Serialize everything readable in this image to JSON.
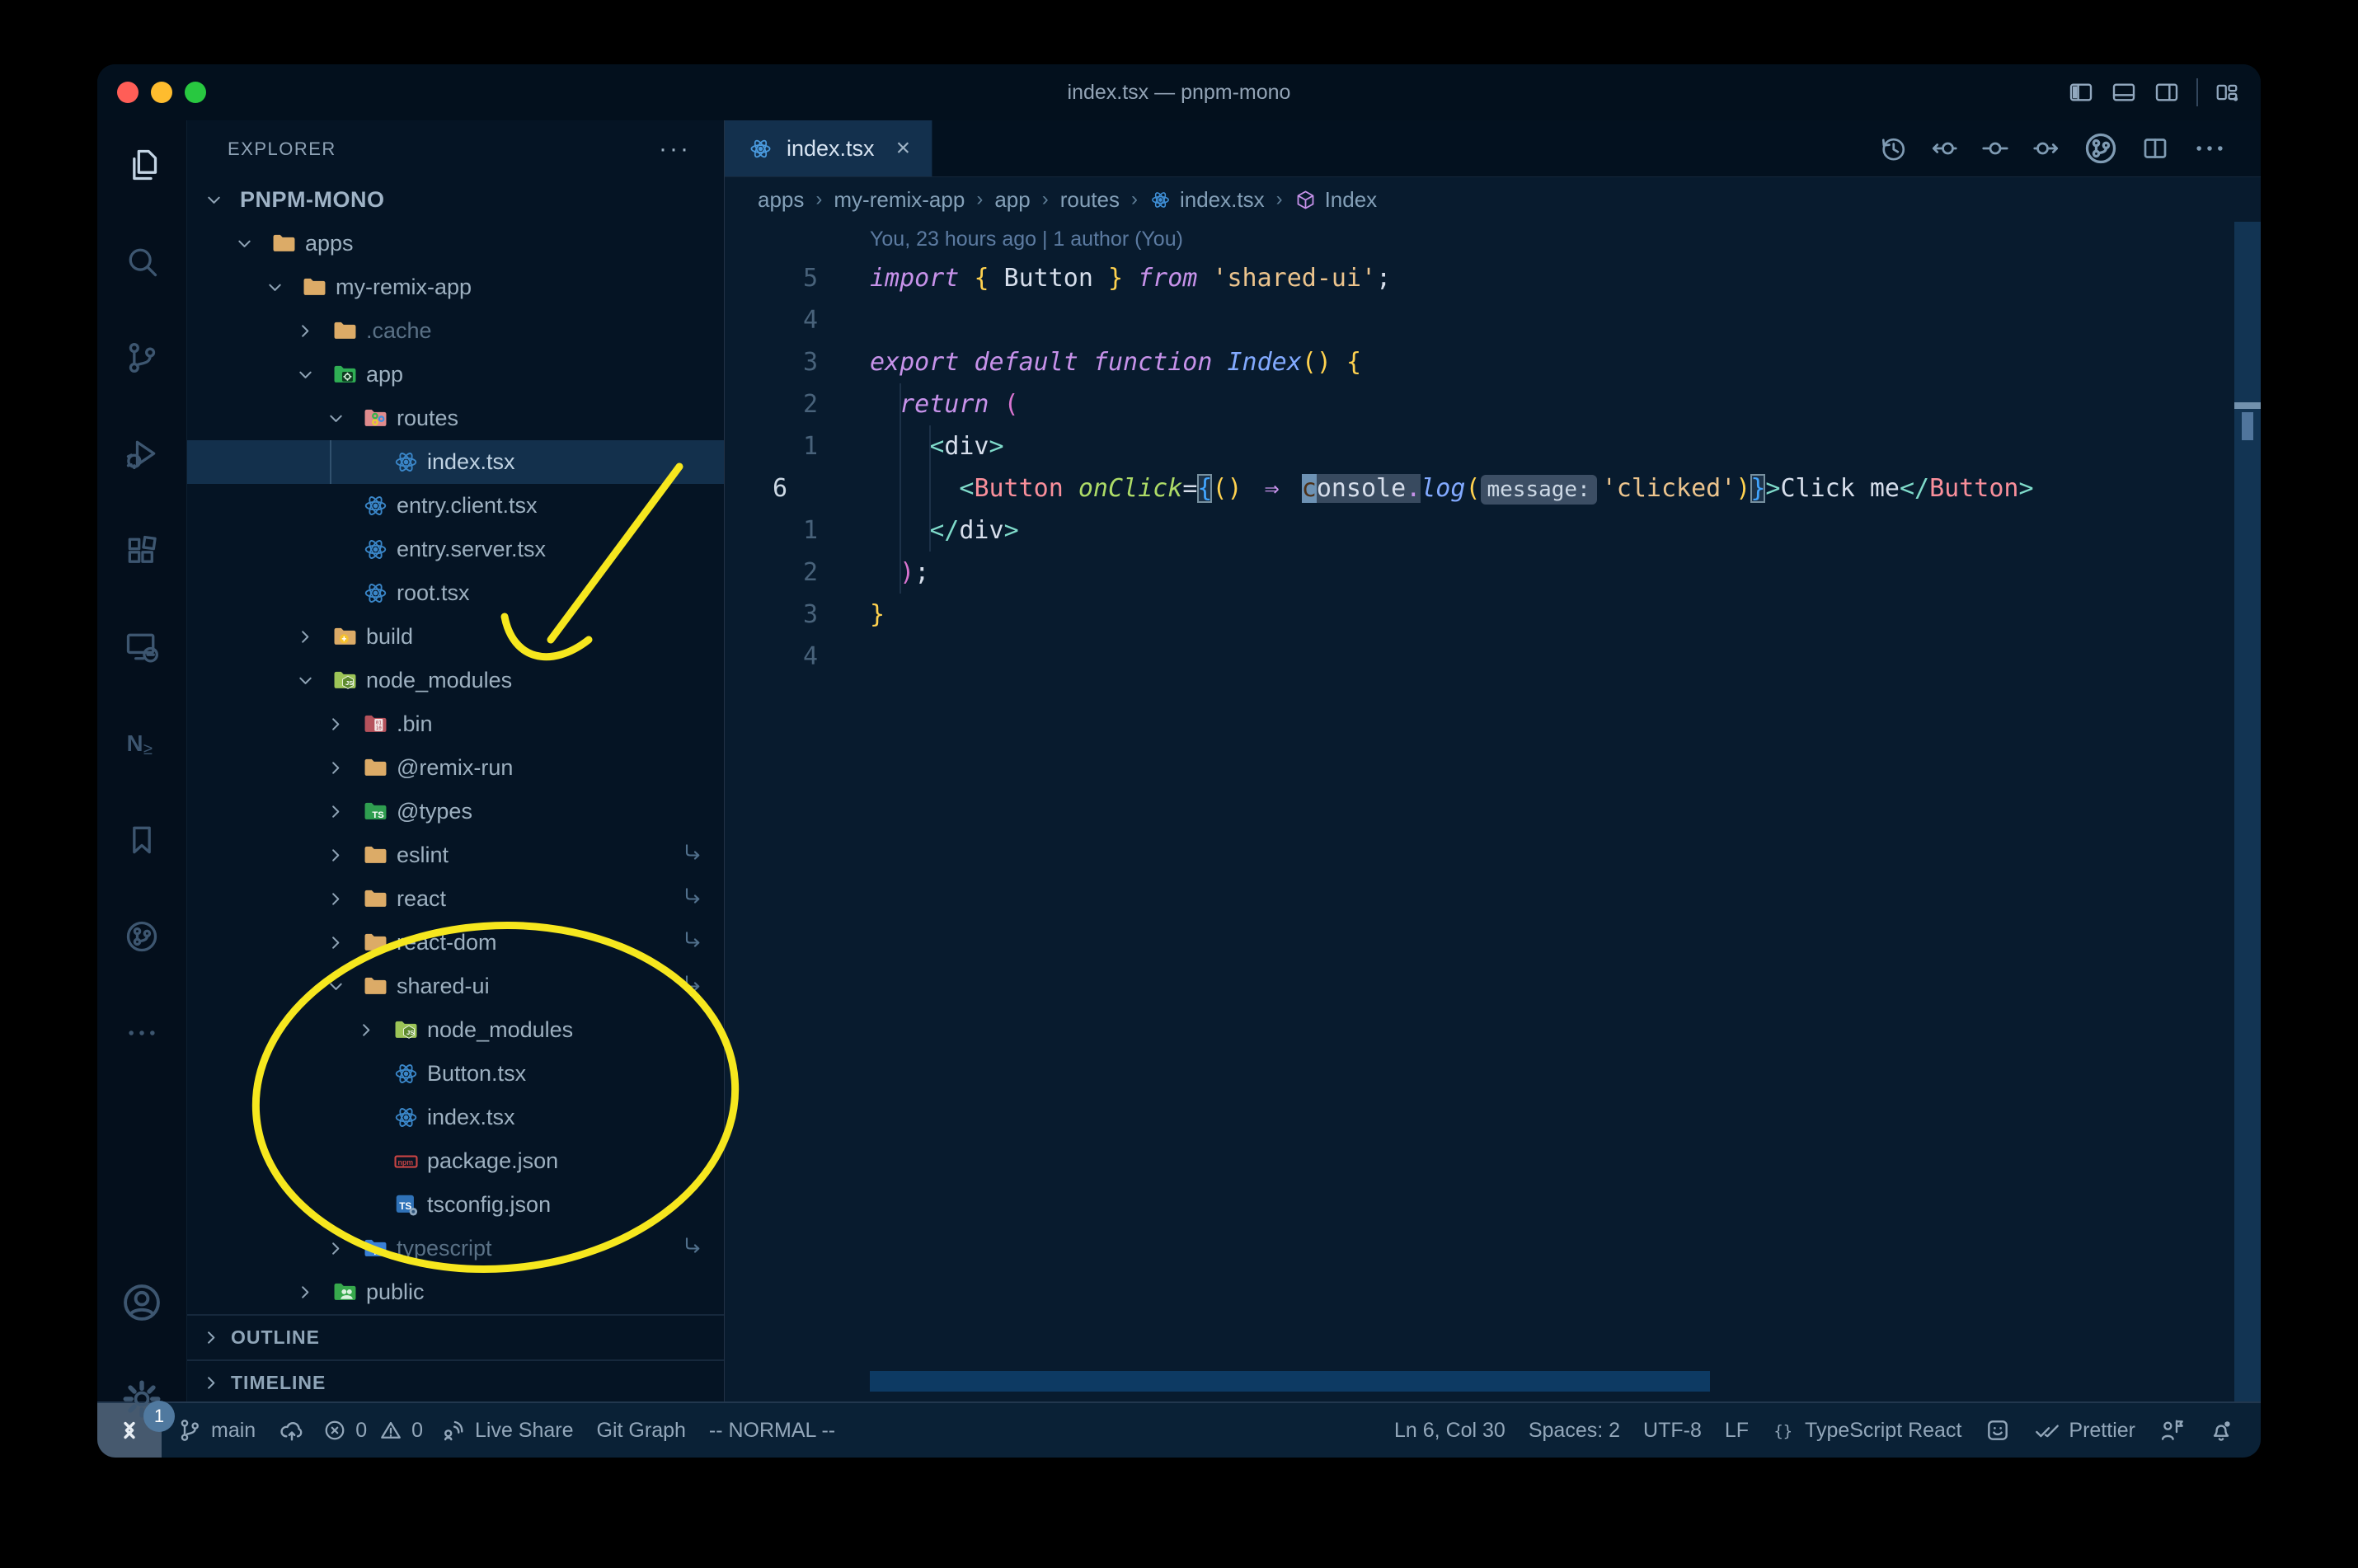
{
  "window": {
    "title": "index.tsx — pnpm-mono"
  },
  "titlebar_actions": [
    {
      "icon": "layout-sidebar-left",
      "name": "toggle-primary-sidebar"
    },
    {
      "icon": "layout-panel",
      "name": "toggle-panel"
    },
    {
      "icon": "layout-sidebar-right",
      "name": "toggle-secondary-sidebar"
    },
    {
      "icon": "sep",
      "name": "separator"
    },
    {
      "icon": "layout-customize",
      "name": "customize-layout"
    }
  ],
  "activity_bar": {
    "items": [
      {
        "icon": "files",
        "name": "explorer",
        "active": true
      },
      {
        "icon": "search",
        "name": "search"
      },
      {
        "icon": "source-control",
        "name": "source-control"
      },
      {
        "icon": "run-debug",
        "name": "run-and-debug"
      },
      {
        "icon": "extensions",
        "name": "extensions"
      },
      {
        "icon": "remote-explorer",
        "name": "remote-explorer"
      },
      {
        "icon": "nx-console",
        "name": "nx-console"
      },
      {
        "icon": "bookmarks",
        "name": "bookmarks"
      },
      {
        "icon": "git-graph",
        "name": "git-graph"
      },
      {
        "icon": "more",
        "name": "additional-views"
      }
    ],
    "bottom": [
      {
        "icon": "account",
        "name": "accounts"
      },
      {
        "icon": "settings",
        "name": "manage",
        "badge": "1"
      }
    ]
  },
  "sidebar": {
    "header": "EXPLORER",
    "header_more": "···",
    "tree": [
      {
        "label": "PNPM-MONO",
        "depth": 0,
        "chevron": "down",
        "root": true
      },
      {
        "label": "apps",
        "depth": 1,
        "icon": "folder-tan",
        "chevron": "down"
      },
      {
        "label": "my-remix-app",
        "depth": 2,
        "icon": "folder-tan",
        "chevron": "down"
      },
      {
        "label": ".cache",
        "depth": 3,
        "icon": "folder-tan",
        "chevron": "right",
        "dimmed": true
      },
      {
        "label": "app",
        "depth": 3,
        "icon": "folder-app",
        "chevron": "down"
      },
      {
        "label": "routes",
        "depth": 4,
        "icon": "folder-routes",
        "chevron": "down"
      },
      {
        "label": "index.tsx",
        "depth": 5,
        "icon": "react",
        "selected": true
      },
      {
        "label": "entry.client.tsx",
        "depth": 4,
        "icon": "react"
      },
      {
        "label": "entry.server.tsx",
        "depth": 4,
        "icon": "react"
      },
      {
        "label": "root.tsx",
        "depth": 4,
        "icon": "react"
      },
      {
        "label": "build",
        "depth": 3,
        "icon": "folder-build",
        "chevron": "right"
      },
      {
        "label": "node_modules",
        "depth": 3,
        "icon": "folder-node",
        "chevron": "down"
      },
      {
        "label": ".bin",
        "depth": 4,
        "icon": "folder-bin",
        "chevron": "right"
      },
      {
        "label": "@remix-run",
        "depth": 4,
        "icon": "folder-tan",
        "chevron": "right"
      },
      {
        "label": "@types",
        "depth": 4,
        "icon": "folder-types",
        "chevron": "right"
      },
      {
        "label": "eslint",
        "depth": 4,
        "icon": "folder-tan",
        "chevron": "right",
        "symlink": true
      },
      {
        "label": "react",
        "depth": 4,
        "icon": "folder-tan",
        "chevron": "right",
        "symlink": true
      },
      {
        "label": "react-dom",
        "depth": 4,
        "icon": "folder-tan",
        "chevron": "right",
        "symlink": true
      },
      {
        "label": "shared-ui",
        "depth": 4,
        "icon": "folder-tan",
        "chevron": "down",
        "symlink": true
      },
      {
        "label": "node_modules",
        "depth": 5,
        "icon": "folder-node",
        "chevron": "right"
      },
      {
        "label": "Button.tsx",
        "depth": 5,
        "icon": "react"
      },
      {
        "label": "index.tsx",
        "depth": 5,
        "icon": "react"
      },
      {
        "label": "package.json",
        "depth": 5,
        "icon": "npm"
      },
      {
        "label": "tsconfig.json",
        "depth": 5,
        "icon": "tsconfig"
      },
      {
        "label": "typescript",
        "depth": 4,
        "icon": "folder-ts",
        "chevron": "right",
        "dimmed": true,
        "symlink": true
      },
      {
        "label": "public",
        "depth": 3,
        "icon": "folder-public",
        "chevron": "right"
      }
    ],
    "sections": [
      {
        "label": "OUTLINE"
      },
      {
        "label": "TIMELINE"
      }
    ]
  },
  "editor": {
    "tab": {
      "label": "index.tsx",
      "icon": "react",
      "close": "×"
    },
    "actions": [
      {
        "icon": "history",
        "name": "timeline-history"
      },
      {
        "icon": "gitlens-prev",
        "name": "open-previous-change"
      },
      {
        "icon": "gitlens-rev",
        "name": "open-revision"
      },
      {
        "icon": "gitlens-next",
        "name": "open-next-change"
      },
      {
        "icon": "git-graph",
        "name": "git-graph-view"
      },
      {
        "icon": "split",
        "name": "split-editor"
      },
      {
        "icon": "more",
        "name": "more-actions"
      }
    ],
    "breadcrumbs": [
      {
        "label": "apps"
      },
      {
        "label": "my-remix-app"
      },
      {
        "label": "app"
      },
      {
        "label": "routes"
      },
      {
        "label": "index.tsx",
        "icon": "react"
      },
      {
        "label": "Index",
        "icon": "symbol-box"
      }
    ],
    "annotation": "You, 23 hours ago | 1 author (You)",
    "code": {
      "lines": [
        {
          "n": "5",
          "tokens": [
            [
              "kw",
              "import"
            ],
            [
              "fg",
              " "
            ],
            [
              "gold",
              "{"
            ],
            [
              "fg",
              " Button "
            ],
            [
              "gold",
              "}"
            ],
            [
              "fg",
              " "
            ],
            [
              "kw",
              "from"
            ],
            [
              "fg",
              " "
            ],
            [
              "str",
              "'shared-ui'"
            ],
            [
              "fg",
              ";"
            ]
          ]
        },
        {
          "n": "4",
          "tokens": []
        },
        {
          "n": "3",
          "tokens": [
            [
              "kw",
              "export"
            ],
            [
              "fg",
              " "
            ],
            [
              "kw",
              "default"
            ],
            [
              "fg",
              " "
            ],
            [
              "kw",
              "function"
            ],
            [
              "fg",
              " "
            ],
            [
              "fn",
              "Index"
            ],
            [
              "gold",
              "()"
            ],
            [
              "fg",
              " "
            ],
            [
              "gold",
              "{"
            ]
          ]
        },
        {
          "n": "2",
          "tokens": [
            [
              "fg",
              "  "
            ],
            [
              "kw",
              "return"
            ],
            [
              "fg",
              " "
            ],
            [
              "orchid",
              "("
            ]
          ]
        },
        {
          "n": "1",
          "tokens": [
            [
              "fg",
              "    "
            ],
            [
              "pt",
              "<"
            ],
            [
              "fg",
              "div"
            ],
            [
              "pt",
              ">"
            ]
          ]
        },
        {
          "n": "6",
          "current": true,
          "tokens": [
            [
              "fg",
              "      "
            ],
            [
              "pt",
              "<"
            ],
            [
              "tag",
              "Button"
            ],
            [
              "fg",
              " "
            ],
            [
              "attr",
              "onClick"
            ],
            [
              "fg",
              "="
            ],
            [
              "bblue bm",
              "{"
            ],
            [
              "gold",
              "()"
            ],
            [
              "fg",
              " "
            ],
            [
              "kw arrow-lig",
              "⇒"
            ],
            [
              "fg",
              " "
            ],
            [
              "cursor",
              "c"
            ],
            [
              "hl",
              "onsole"
            ],
            [
              "dot hlbg",
              "."
            ],
            [
              "fn",
              "log"
            ],
            [
              "gold",
              "("
            ],
            [
              "inlay",
              "message:"
            ],
            [
              "str",
              "'clicked'"
            ],
            [
              "gold",
              ")"
            ],
            [
              "bblue bm",
              "}"
            ],
            [
              "pt",
              ">"
            ],
            [
              "fg",
              "Click me"
            ],
            [
              "pt",
              "</"
            ],
            [
              "tag",
              "Button"
            ],
            [
              "pt",
              ">"
            ]
          ]
        },
        {
          "n": "1",
          "tokens": [
            [
              "fg",
              "    "
            ],
            [
              "pt",
              "</"
            ],
            [
              "fg",
              "div"
            ],
            [
              "pt",
              ">"
            ]
          ]
        },
        {
          "n": "2",
          "tokens": [
            [
              "fg",
              "  "
            ],
            [
              "orchid",
              ")"
            ],
            [
              "fg",
              ";"
            ]
          ]
        },
        {
          "n": "3",
          "tokens": [
            [
              "gold",
              "}"
            ]
          ]
        },
        {
          "n": "4",
          "tokens": []
        }
      ]
    }
  },
  "status_bar": {
    "left": [
      {
        "icon": "remote",
        "name": "remote-indicator",
        "boxed": true
      },
      {
        "icon": "branch",
        "label": "main",
        "name": "branch"
      },
      {
        "icon": "cloud-upload",
        "name": "publish-changes"
      },
      {
        "icon": "error",
        "label": "0",
        "name": "errors",
        "tight": true
      },
      {
        "icon": "warning",
        "label": "0",
        "name": "warnings",
        "tight": true
      },
      {
        "icon": "live-share",
        "label": "Live Share",
        "name": "live-share"
      },
      {
        "label": "Git Graph",
        "name": "git-graph"
      },
      {
        "label": "-- NORMAL --",
        "name": "vim-mode"
      }
    ],
    "right": [
      {
        "label": "Ln 6, Col 30",
        "name": "cursor-position"
      },
      {
        "label": "Spaces: 2",
        "name": "indentation"
      },
      {
        "label": "UTF-8",
        "name": "encoding"
      },
      {
        "label": "LF",
        "name": "end-of-line"
      },
      {
        "icon": "braces",
        "label": "TypeScript React",
        "name": "language-mode"
      },
      {
        "icon": "feedback",
        "name": "feedback"
      },
      {
        "icon": "double-check",
        "label": "Prettier",
        "name": "formatter"
      },
      {
        "icon": "person-flag",
        "name": "screen-sharing"
      },
      {
        "icon": "bell",
        "name": "notifications"
      }
    ]
  },
  "annotations": {
    "color": "#f6e71e",
    "shapes": [
      "arrow-to-node-modules",
      "ellipse-around-shared-ui"
    ]
  },
  "colors": {
    "keyword": "#c792ea",
    "string": "#ecc48d",
    "function": "#82aaff",
    "jsx_tag": "#f98f9b",
    "attribute": "#addb67",
    "punct_teal": "#7fdbca",
    "bracket_gold": "#ffd24f",
    "bracket_orchid": "#d974d0",
    "bracket_blue": "#42a5ff",
    "accent_yellow": "#f6e71e"
  }
}
